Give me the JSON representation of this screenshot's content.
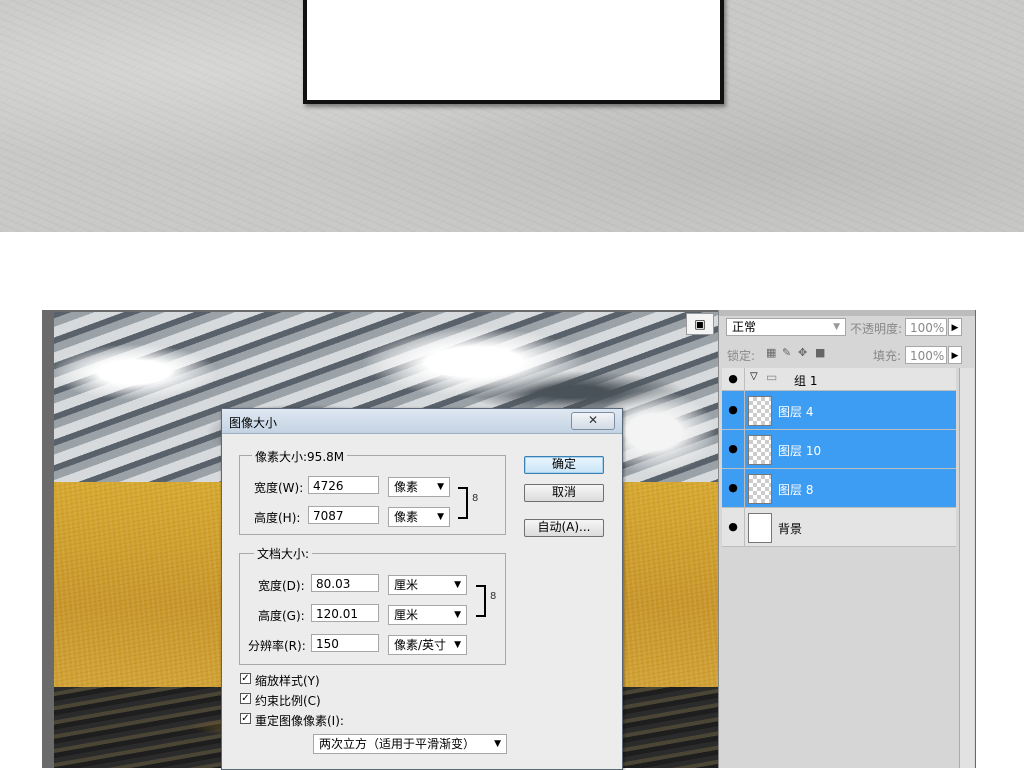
{
  "dialog": {
    "title": "图像大小",
    "close_glyph": "✕",
    "pixel_dims": {
      "legend": "像素大小:95.8M",
      "width_label": "宽度(W):",
      "width_value": "4726",
      "width_unit": "像素",
      "height_label": "高度(H):",
      "height_value": "7087",
      "height_unit": "像素"
    },
    "doc_size": {
      "legend": "文档大小:",
      "width_label": "宽度(D):",
      "width_value": "80.03",
      "width_unit": "厘米",
      "height_label": "高度(G):",
      "height_value": "120.01",
      "height_unit": "厘米",
      "res_label": "分辨率(R):",
      "res_value": "150",
      "res_unit": "像素/英寸"
    },
    "checkboxes": {
      "scale_styles": "缩放样式(Y)",
      "constrain": "约束比例(C)",
      "resample": "重定图像像素(I):"
    },
    "resample_method": "两次立方（适用于平滑渐变）",
    "buttons": {
      "ok": "确定",
      "cancel": "取消",
      "auto": "自动(A)..."
    }
  },
  "layers_panel": {
    "blend_mode": "正常",
    "opacity_label": "不透明度:",
    "opacity_value": "100%",
    "lock_label": "锁定:",
    "fill_label": "填充:",
    "fill_value": "100%",
    "layers": [
      {
        "name": "组 1",
        "type": "group",
        "selected": false
      },
      {
        "name": "图层 4",
        "type": "layer",
        "selected": true
      },
      {
        "name": "图层 10",
        "type": "layer",
        "selected": true
      },
      {
        "name": "图层 8",
        "type": "layer",
        "selected": true
      },
      {
        "name": "背景",
        "type": "background",
        "selected": false
      }
    ]
  },
  "colors": {
    "selection": "#3d9df2",
    "dialog_bg": "#ececec"
  }
}
